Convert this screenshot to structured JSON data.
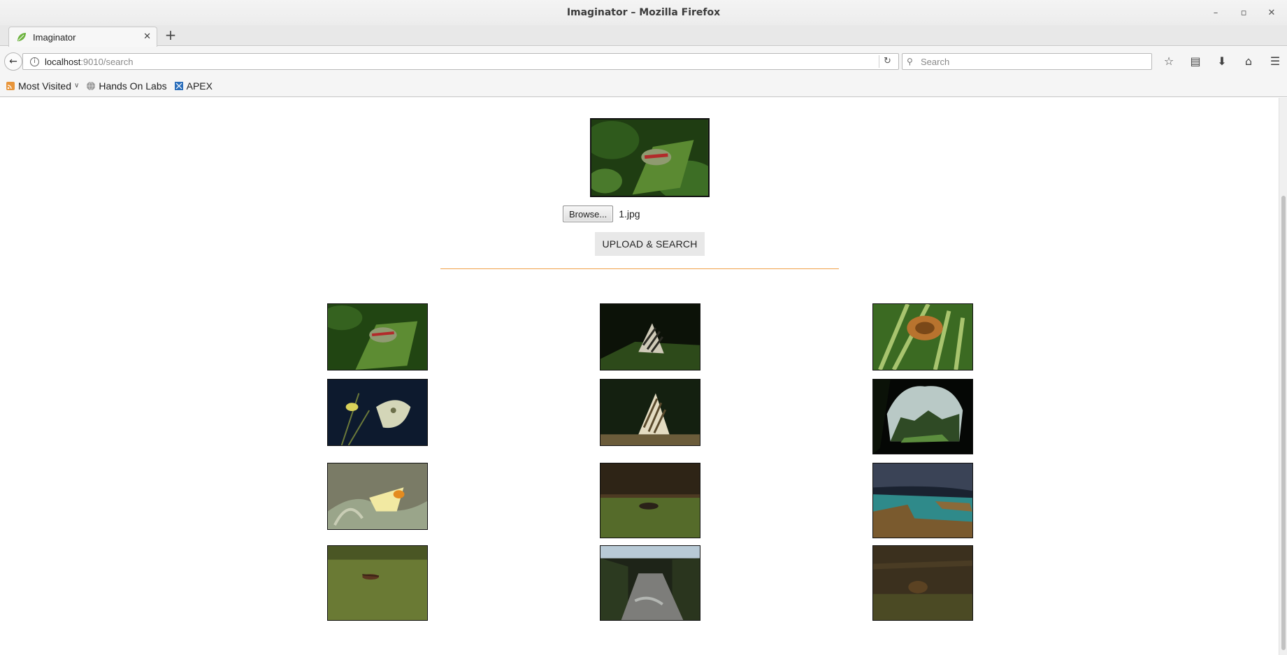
{
  "window": {
    "title": "Imaginator – Mozilla Firefox"
  },
  "tab": {
    "label": "Imaginator"
  },
  "nav": {
    "url_host": "localhost",
    "url_rest": ":9010/search",
    "search_placeholder": "Search"
  },
  "bookmarks": {
    "items": [
      {
        "label": "Most Visited"
      },
      {
        "label": "Hands On Labs"
      },
      {
        "label": "APEX"
      }
    ]
  },
  "upload": {
    "browse_label": "Browse...",
    "file_name": "1.jpg",
    "submit_label": "UPLOAD & SEARCH"
  },
  "colors": {
    "divider": "#f0a24a"
  }
}
